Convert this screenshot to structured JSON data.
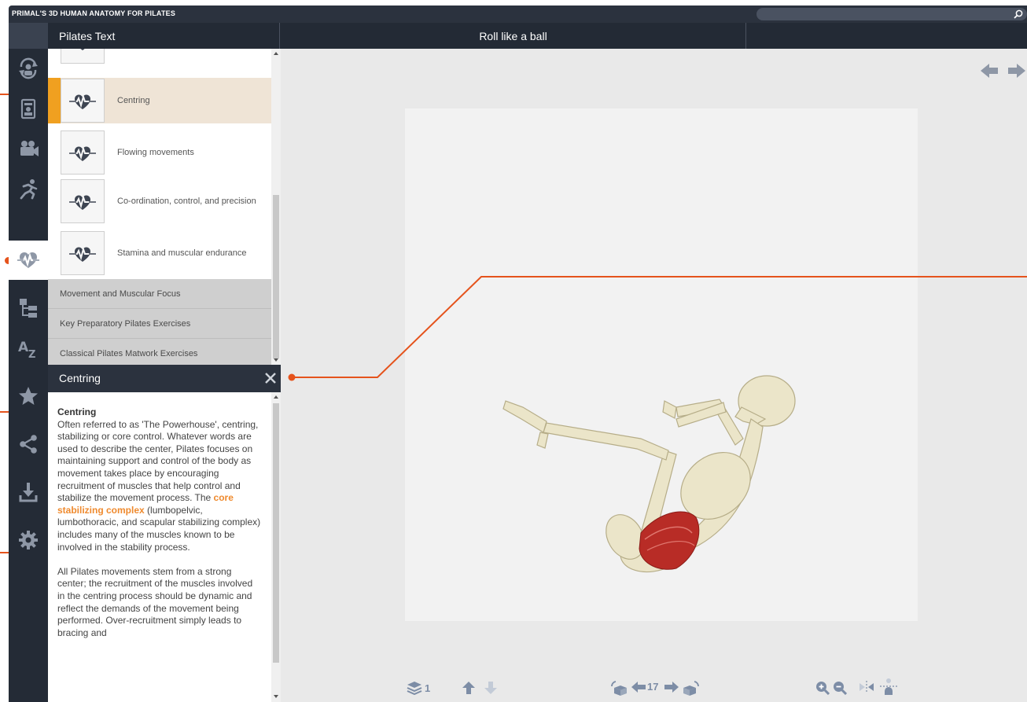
{
  "app": {
    "title": "PRIMAL'S 3D HUMAN ANATOMY FOR PILATES"
  },
  "search": {
    "placeholder": ""
  },
  "header": {
    "left_title": "Pilates Text",
    "center_title": "Roll like a ball"
  },
  "sidebar": {
    "icons": [
      "rotate-view-icon",
      "skeleton-layers-icon",
      "video-camera-icon",
      "running-figure-icon",
      "heartbeat-icon",
      "hierarchy-tree-icon",
      "a-to-z-icon",
      "star-icon",
      "share-icon",
      "download-icon",
      "settings-gear-icon"
    ],
    "active": "heartbeat-icon"
  },
  "topics": {
    "items": [
      {
        "label": "Centring",
        "selected": true
      },
      {
        "label": "Flowing movements",
        "selected": false
      },
      {
        "label": "Co-ordination, control, and precision",
        "selected": false
      },
      {
        "label": "Stamina and muscular endurance",
        "selected": false
      }
    ],
    "sections": [
      {
        "label": "Movement and Muscular Focus"
      },
      {
        "label": "Key Preparatory Pilates Exercises"
      },
      {
        "label": "Classical Pilates Matwork Exercises"
      }
    ]
  },
  "detail": {
    "title": "Centring",
    "heading": "Centring",
    "para1_before": "Often referred to as 'The Powerhouse', centring, stabilizing or core control. Whatever words are used to describe the center, Pilates focuses on maintaining support and control of the body as movement takes place by encouraging recruitment of muscles that help control and stabilize the movement process. The ",
    "para1_link": "core stabilizing complex",
    "para1_after": " (lumbopelvic, lumbothoracic, and scapular stabilizing complex) includes many of the muscles known to be involved in the stability process.",
    "para2": "All Pilates movements stem from a strong center; the recruitment of the muscles involved in the centring process should be dynamic and reflect the demands of the movement being performed. Over-recruitment simply leads to bracing and"
  },
  "viewer": {
    "layer_count": "1",
    "rotation_frame": "17"
  },
  "colors": {
    "accent": "#f0a020",
    "callout": "#e5531c",
    "link": "#ef8a2e",
    "dark": "#242b36"
  }
}
